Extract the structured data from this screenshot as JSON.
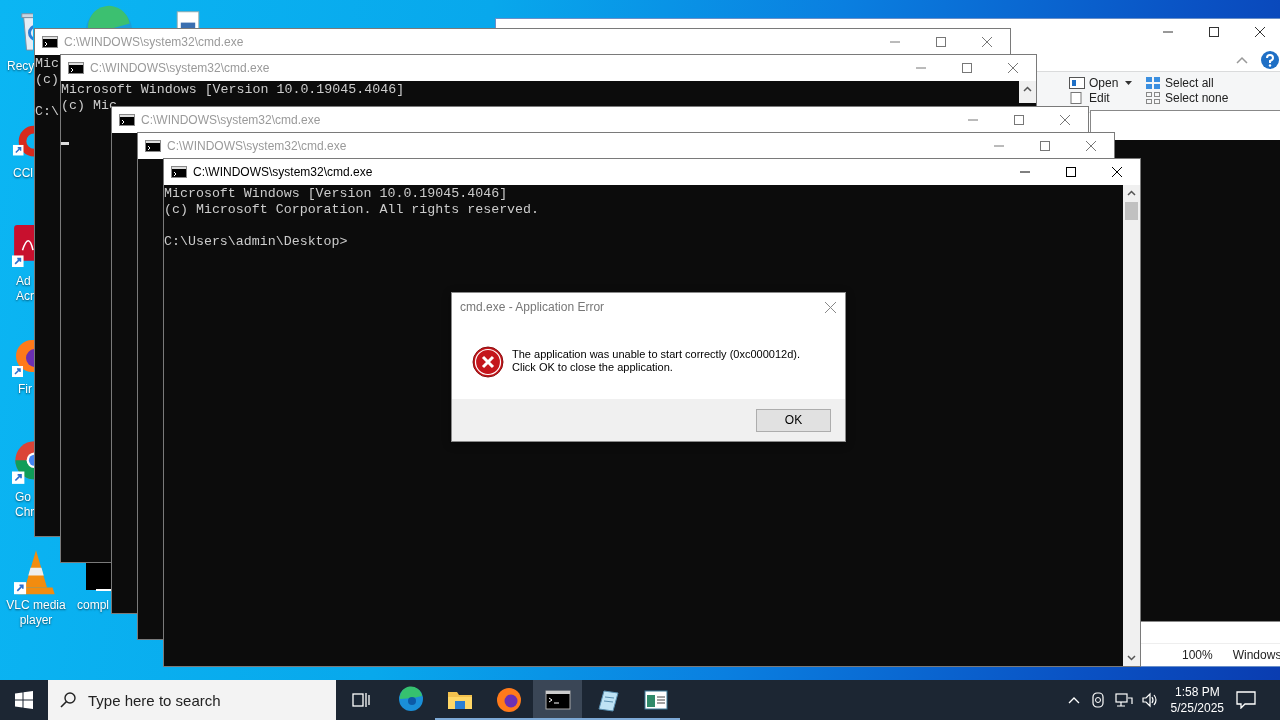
{
  "desktop_icons": [
    {
      "kind": "bin",
      "label": [
        "Recy"
      ]
    },
    {
      "kind": "edge"
    },
    {
      "kind": "file"
    },
    {
      "kind": "ccleaner",
      "label": [
        "CCl"
      ]
    },
    {
      "kind": "acrobat",
      "label": [
        "Ad",
        "Acr"
      ]
    },
    {
      "kind": "firefox",
      "label": [
        "Fir"
      ]
    },
    {
      "kind": "chrome",
      "label": [
        "Go",
        "Chr"
      ]
    },
    {
      "kind": "vlc",
      "label": [
        "VLC media",
        "player"
      ]
    },
    {
      "kind": "console",
      "label": [
        "compl"
      ]
    }
  ],
  "explorer": {
    "ribbon": [
      {
        "label": "Open",
        "dropdown": true,
        "kind": "open"
      },
      {
        "label": "Edit",
        "dropdown": false,
        "kind": "edit"
      },
      {
        "label": "Select all",
        "dropdown": false,
        "kind": "selectall"
      },
      {
        "label": "Select none",
        "dropdown": false,
        "kind": "selectnone"
      }
    ],
    "status": [
      "100%",
      "Windows"
    ]
  },
  "console_windows": [
    {
      "title": "C:\\WINDOWS\\system32\\cmd.exe",
      "active": false,
      "cursor": false,
      "output": [
        "Mic",
        "(c)"
      ],
      "prompt": "C:\\"
    },
    {
      "title": "C:\\WINDOWS\\system32\\cmd.exe",
      "active": false,
      "cursor": true,
      "output": [
        "Microsoft Windows [Version 10.0.19045.4046]",
        "(c) Mic"
      ]
    },
    {
      "title": "C:\\WINDOWS\\system32\\cmd.exe",
      "active": false,
      "cursor": false
    },
    {
      "title": "C:\\WINDOWS\\system32\\cmd.exe",
      "active": false,
      "cursor": false
    },
    {
      "title": "C:\\WINDOWS\\system32\\cmd.exe",
      "active": true,
      "cursor": false,
      "output": [
        "Microsoft Windows [Version 10.0.19045.4046]",
        "(c) Microsoft Corporation. All rights reserved."
      ],
      "prompt": "C:\\Users\\admin\\Desktop>"
    }
  ],
  "dialog": {
    "title": "cmd.exe - Application Error",
    "message": "The application was unable to start correctly (0xc000012d).\nClick OK to close the application.",
    "button": "OK"
  },
  "taskbar": {
    "search": {
      "placeholder": "Type here to search"
    },
    "apps": [
      {
        "kind": "edge",
        "running": false,
        "selected": false
      },
      {
        "kind": "folder",
        "running": true,
        "selected": false
      },
      {
        "kind": "firefox",
        "running": true,
        "selected": false
      },
      {
        "kind": "console",
        "running": true,
        "selected": true
      },
      {
        "kind": "notepad",
        "running": true,
        "selected": false
      },
      {
        "kind": "window",
        "running": true,
        "selected": false
      }
    ],
    "clock": {
      "time": "1:58 PM",
      "date": "5/25/2025"
    }
  }
}
